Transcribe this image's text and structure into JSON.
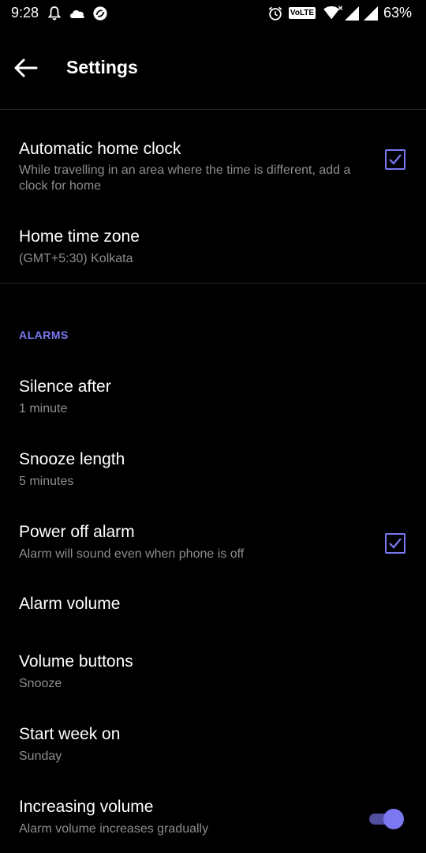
{
  "status_bar": {
    "time": "9:28",
    "network_badge": "VoLTE",
    "battery": "63%",
    "icons": [
      "bell-icon",
      "cloud-icon",
      "sync-icon",
      "alarm-clock-icon",
      "wifi-icon",
      "signal-icon",
      "signal-icon",
      "battery-icon"
    ]
  },
  "toolbar": {
    "title": "Settings",
    "back_icon": "arrow-back-icon"
  },
  "clock": {
    "auto_home_clock": {
      "title": "Automatic home clock",
      "summary": "While travelling in an area where the time is different, add a clock for home",
      "checked": true
    },
    "home_time_zone": {
      "title": "Home time zone",
      "summary": "(GMT+5:30) Kolkata"
    }
  },
  "alarms": {
    "header": "ALARMS",
    "silence_after": {
      "title": "Silence after",
      "summary": "1 minute"
    },
    "snooze_length": {
      "title": "Snooze length",
      "summary": "5 minutes"
    },
    "power_off_alarm": {
      "title": "Power off alarm",
      "summary": "Alarm will sound even when phone is off",
      "checked": true
    },
    "alarm_volume": {
      "title": "Alarm volume"
    },
    "volume_buttons": {
      "title": "Volume buttons",
      "summary": "Snooze"
    },
    "start_week_on": {
      "title": "Start week on",
      "summary": "Sunday"
    },
    "increasing_volume": {
      "title": "Increasing volume",
      "summary": "Alarm volume increases gradually",
      "enabled": true
    }
  },
  "colors": {
    "background": "#000000",
    "accent": "#7b78f2",
    "summary_text": "#8d8d8d",
    "divider": "#262626"
  }
}
